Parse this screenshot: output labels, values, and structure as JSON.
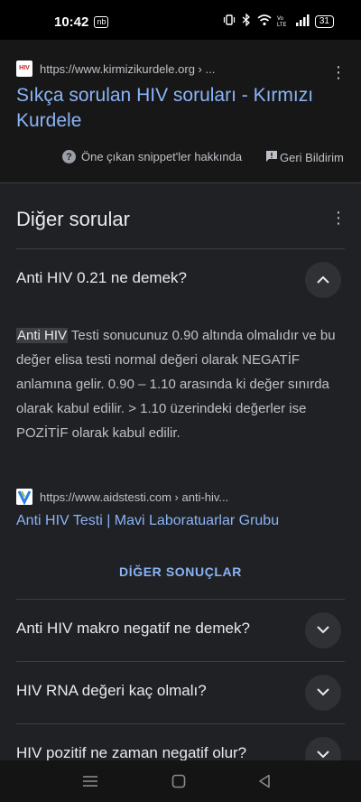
{
  "status_bar": {
    "time": "10:42",
    "badge": "nb",
    "battery": "31",
    "icons": [
      "vibrate-icon",
      "bluetooth-icon",
      "wifi-icon",
      "volte-icon",
      "signal-icon",
      "battery-icon"
    ]
  },
  "top_result": {
    "favicon": "hiv-favicon",
    "favicon_text": "HIV",
    "url": "https://www.kirmizikurdele.org › ...",
    "title": "Sıkça sorulan HIV soruları - Kırmızı Kurdele",
    "snippet_about": "Öne çıkan snippet'ler hakkında",
    "feedback": "Geri Bildirim"
  },
  "other_questions": {
    "title": "Diğer sorular",
    "expanded": {
      "question": "Anti HIV 0.21 ne demek?",
      "answer_highlight": "Anti HIV",
      "answer_rest": " Testi sonucunuz 0.90 altında olmalıdır ve bu değer elisa testi normal değeri olarak NEGATİF anlamına gelir. 0.90 – 1.10 arasında ki değer sınırda olarak kabul edilir. > 1.10 üzerindeki değerler ise POZİTİF olarak kabul edilir.",
      "source_url": "https://www.aidstesti.com › anti-hiv...",
      "source_title": "Anti HIV Testi | Mavi Laboratuarlar Grubu"
    },
    "more_button": "DİĞER SONUÇLAR",
    "questions": [
      "Anti HIV makro negatif ne demek?",
      "HIV RNA değeri kaç olmalı?",
      "HIV pozitif ne zaman negatif olur?"
    ]
  },
  "nav_bar": {
    "icons": [
      "menu-icon",
      "home-icon",
      "back-icon"
    ]
  },
  "colors": {
    "background": "#202124",
    "link": "#8ab4f8",
    "text": "#e8eaed"
  }
}
